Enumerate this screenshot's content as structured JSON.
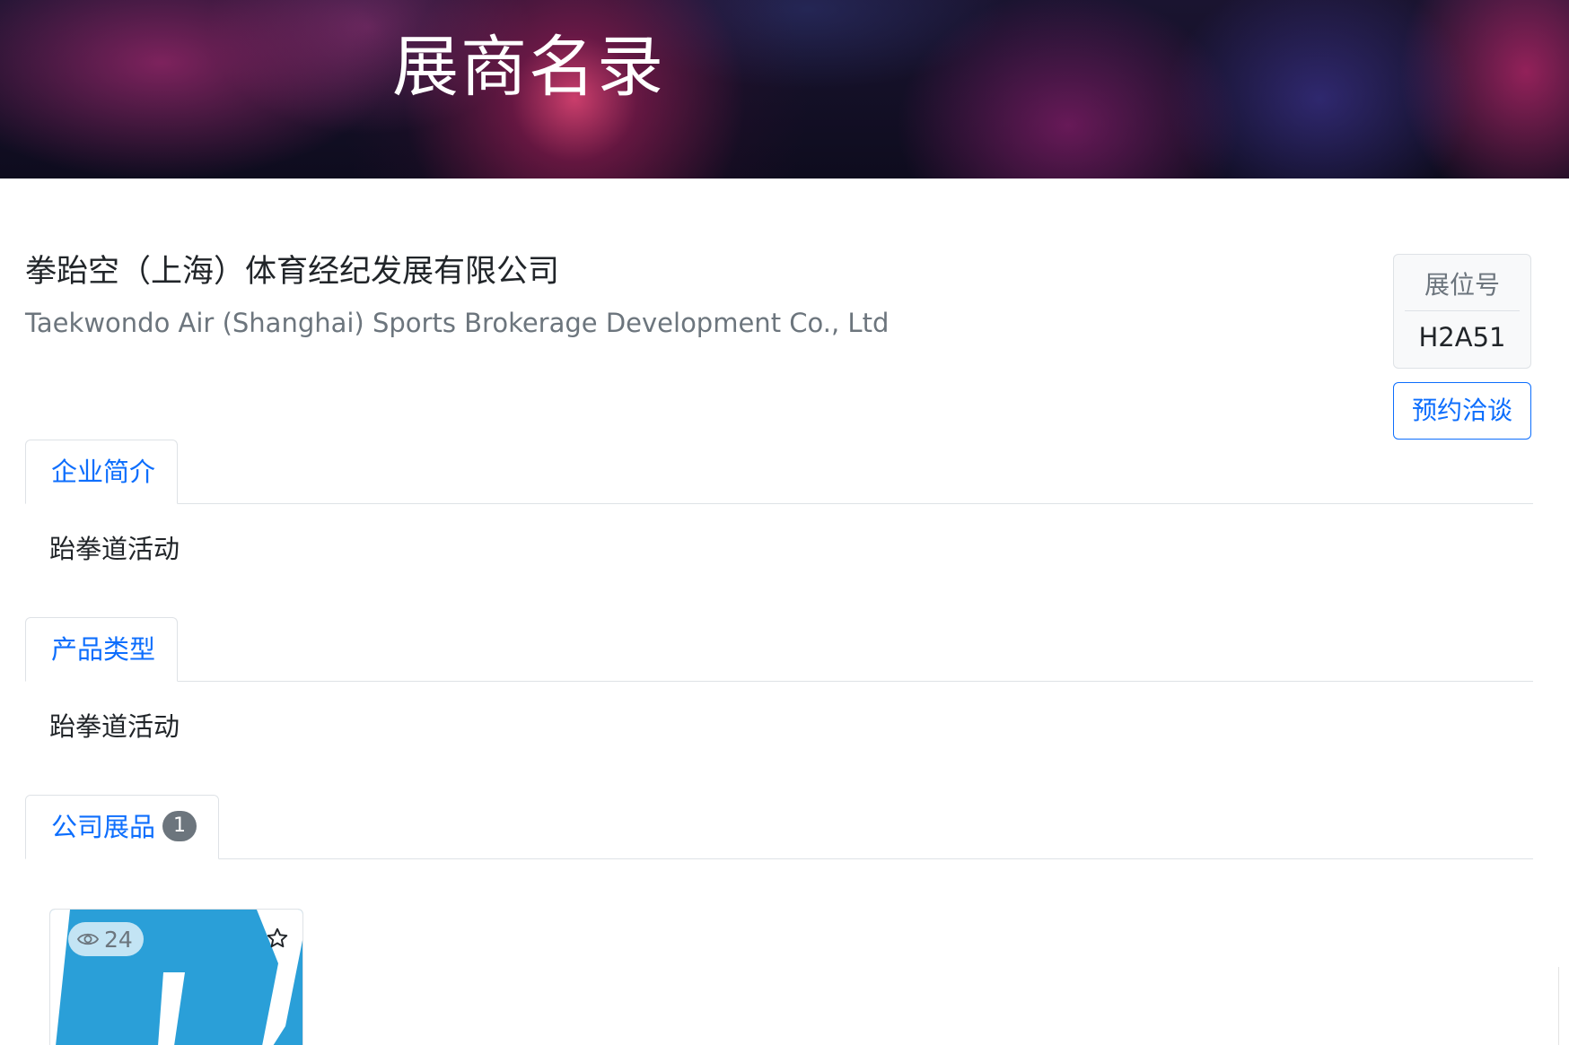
{
  "header": {
    "title": "展商名录"
  },
  "company": {
    "name_cn": "拳跆空（上海）体育经纪发展有限公司",
    "name_en": "Taekwondo Air (Shanghai) Sports Brokerage Development Co., Ltd"
  },
  "booth": {
    "label": "展位号",
    "number": "H2A51"
  },
  "actions": {
    "appointment_label": "预约洽谈"
  },
  "sections": {
    "intro": {
      "tab_label": "企业简介",
      "content": "跆拳道活动"
    },
    "product_type": {
      "tab_label": "产品类型",
      "content": "跆拳道活动"
    },
    "exhibits": {
      "tab_label": "公司展品",
      "count": "1"
    }
  },
  "products": [
    {
      "views": "24",
      "icon": "eye-icon",
      "favorite_icon": "star-outline-icon",
      "image": "blue-W-logo"
    }
  ],
  "colors": {
    "primary": "#0d6efd",
    "muted": "#6c757d",
    "logo_blue": "#2a9fd8"
  }
}
